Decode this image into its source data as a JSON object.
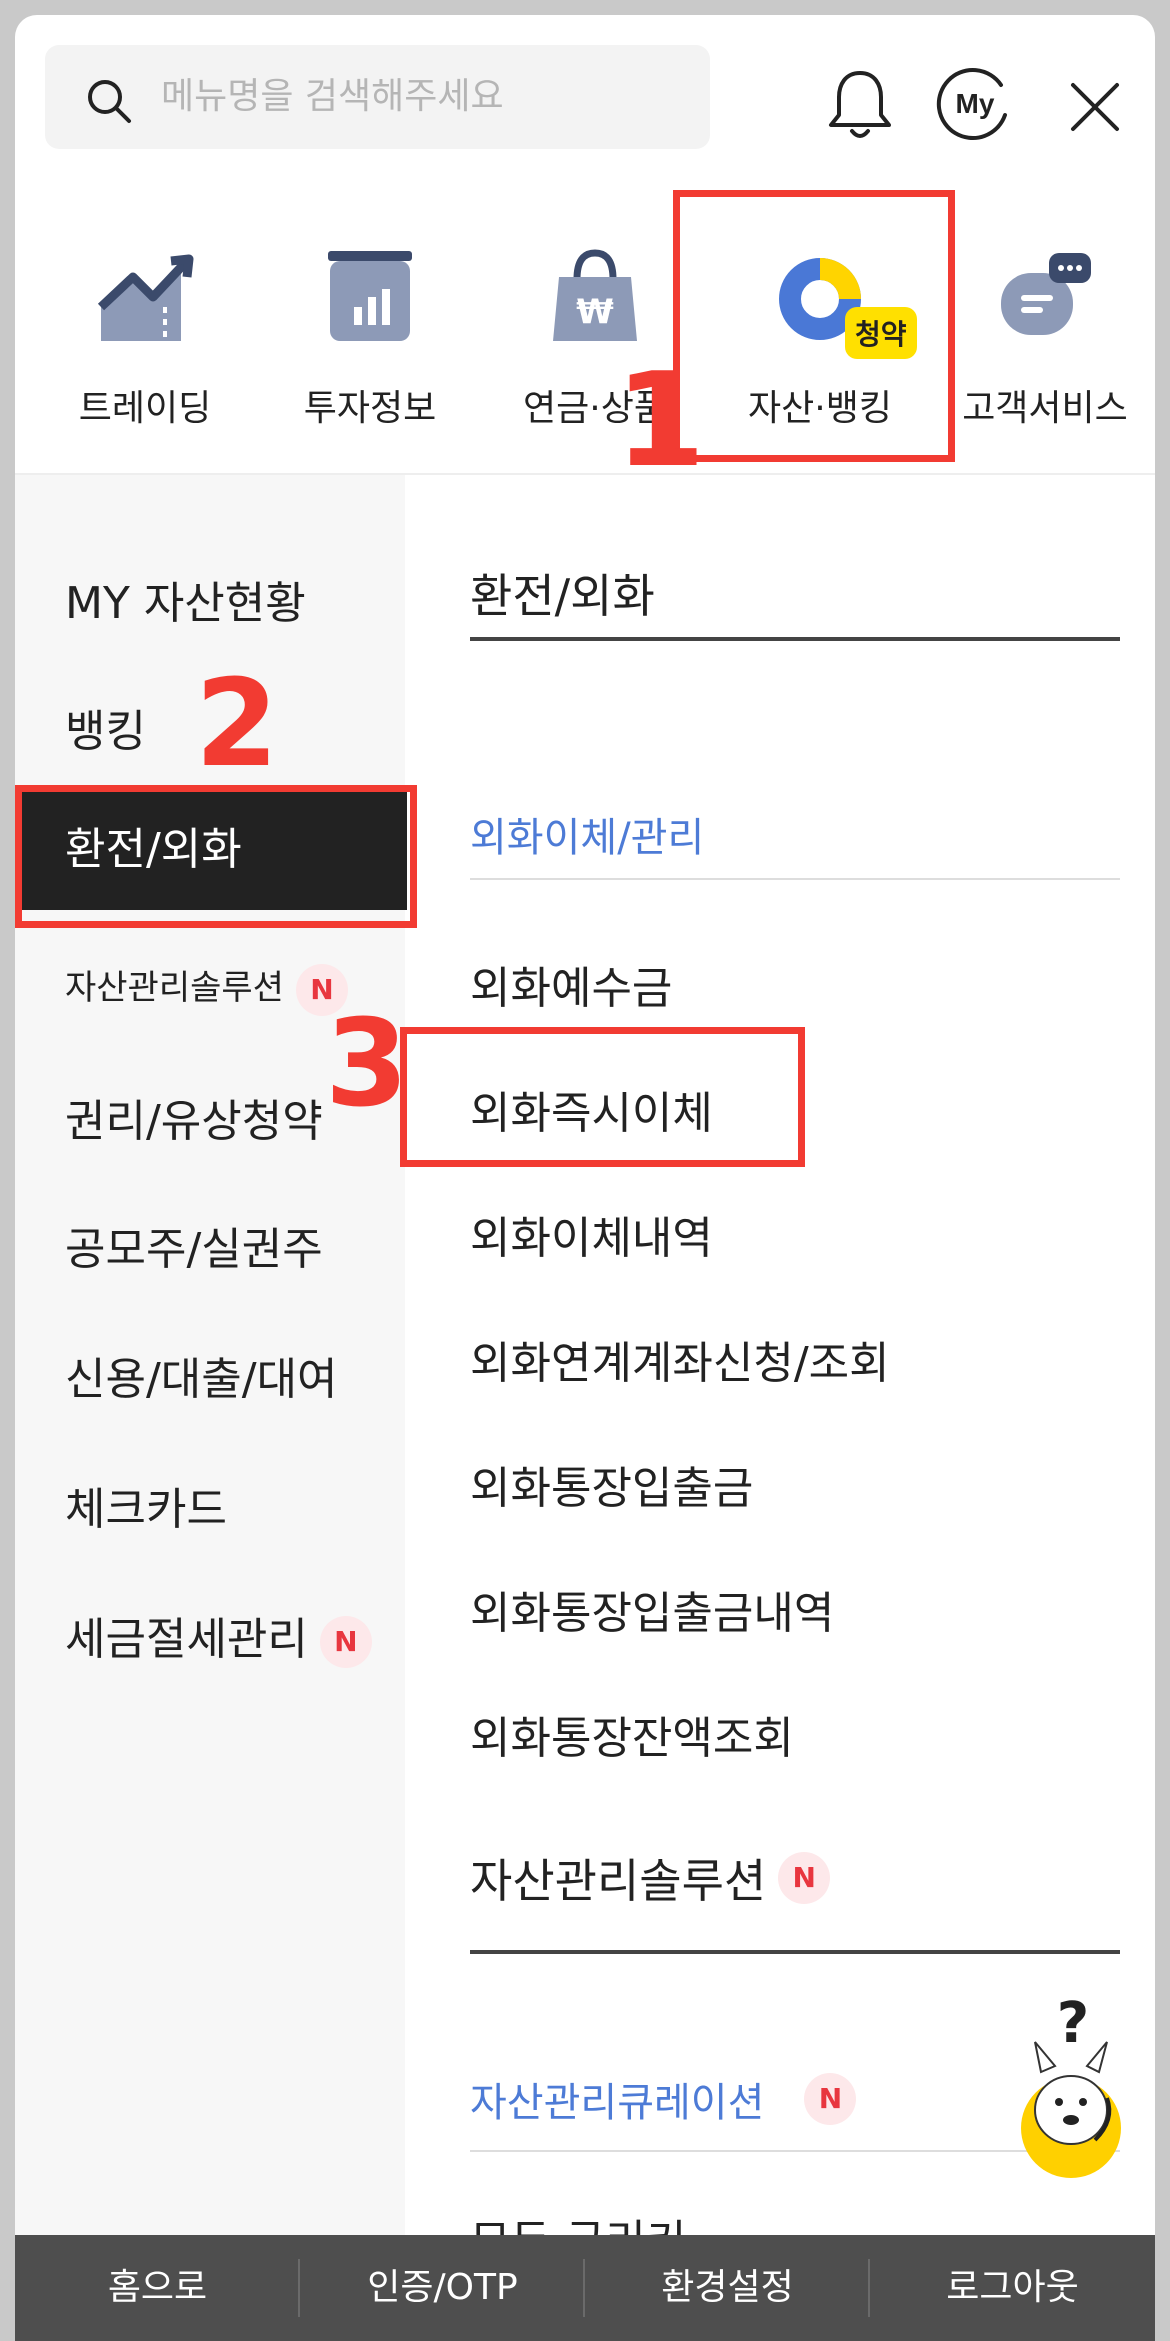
{
  "search": {
    "placeholder": "메뉴명을 검색해주세요"
  },
  "header": {
    "my_label": "My"
  },
  "categories": [
    {
      "label": "트레이딩",
      "icon": "chart-up-icon"
    },
    {
      "label": "투자정보",
      "icon": "bar-chart-icon"
    },
    {
      "label": "연금·상품",
      "icon": "money-bag-icon"
    },
    {
      "label": "자산·뱅킹",
      "icon": "donut-chart-icon",
      "badge": "청약"
    },
    {
      "label": "고객서비스",
      "icon": "chat-icon"
    }
  ],
  "annotations": {
    "step1": "1",
    "step2": "2",
    "step3": "3"
  },
  "left_menu": [
    {
      "label": "MY 자산현황"
    },
    {
      "label": "뱅킹"
    },
    {
      "label": "환전/외화",
      "active": true
    },
    {
      "label": "자산관리솔루션",
      "badge": "N"
    },
    {
      "label": "권리/유상청약"
    },
    {
      "label": "공모주/실권주"
    },
    {
      "label": "신용/대출/대여"
    },
    {
      "label": "체크카드"
    },
    {
      "label": "세금절세관리",
      "badge": "N"
    }
  ],
  "right_panel": {
    "section1_title": "환전/외화",
    "section1_sub": "외화이체/관리",
    "items": [
      "외화예수금",
      "외화즉시이체",
      "외화이체내역",
      "외화연계계좌신청/조회",
      "외화통장입출금",
      "외화통장입출금내역",
      "외화통장잔액조회"
    ],
    "section2_title": "자산관리솔루션",
    "section2_badge": "N",
    "section2_sub": "자산관리큐레이션",
    "section2_sub_badge": "N",
    "section2_partial": "모두 규리키"
  },
  "bottom_bar": [
    "홈으로",
    "인증/OTP",
    "환경설정",
    "로그아웃"
  ],
  "colors": {
    "accent_red": "#f23b32",
    "link_blue": "#4d7bd6",
    "active_bg": "#222222",
    "badge_yellow": "#ffe000",
    "bottom_bar": "#4e4e4e"
  }
}
